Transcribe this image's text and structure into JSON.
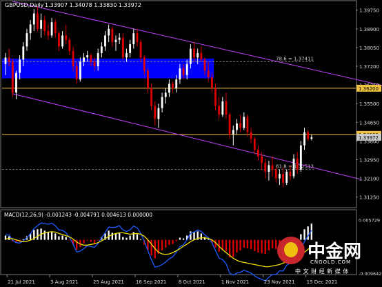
{
  "header": {
    "symbol": "GBPUSD,Daily",
    "ohlc": "1.33907 1.34078 1.33830 1.33972"
  },
  "watermark": {
    "brand": "中金网",
    "domain_sub": "CNGOLD.COM",
    "tagline": "中 文 财 经 新 媒 体"
  },
  "indicator": {
    "label": "MACD(12,26,9) -0.001243 -0.004791 0.004613 0.000000"
  },
  "colors": {
    "background": "#000000",
    "bull_candle": "#ffffff",
    "bear_candle": "#e00000",
    "channel_line": "#c040ff",
    "resistance_zone": "#0000ff",
    "horizontal_level": "#f0c040",
    "macd_signal": "#f0e000",
    "macd_line": "#1e5bff",
    "macd_hist_pos": "#ffffff",
    "macd_hist_neg": "#e00000"
  },
  "chart_data": {
    "type": "candlestick",
    "symbol": "GBPUSD",
    "timeframe": "Daily",
    "price_axis_ticks": [
      "1.39750",
      "1.38900",
      "1.38050",
      "1.37200",
      "1.36350",
      "1.35500",
      "1.34650",
      "1.33800",
      "1.32950",
      "1.32100",
      "1.31250"
    ],
    "ylim": [
      1.308,
      1.4015
    ],
    "x_ticks": [
      "21 Jul 2021",
      "3 Aug 2021",
      "25 Aug 2021",
      "16 Sep 2021",
      "8 Oct 2021",
      "1 Nov 2021",
      "23 Nov 2021",
      "15 Dec 2021"
    ],
    "levels": [
      {
        "label": "78.6 = 1.37411",
        "value": 1.37411,
        "style": "dashed"
      },
      {
        "label": "1.36200",
        "value": 1.362,
        "style": "solid",
        "tag": true
      },
      {
        "label": "1.34100",
        "value": 1.341,
        "style": "solid",
        "tag": true
      },
      {
        "label": "1.33972",
        "value": 1.33972,
        "style": "tag"
      },
      {
        "label": "61.8 = 1.32513",
        "value": 1.32513,
        "style": "dashed"
      }
    ],
    "resistance_zone": {
      "from": 1.3665,
      "to": 1.3755
    },
    "channel": {
      "upper": [
        {
          "date_index": 2,
          "price": 1.4015
        },
        {
          "date_index": 108,
          "price": 1.3625
        }
      ],
      "lower": [
        {
          "date_index": 2,
          "price": 1.3595
        },
        {
          "date_index": 100,
          "price": 1.3205
        }
      ]
    },
    "candles": [
      [
        1.373,
        1.378,
        1.368,
        1.376
      ],
      [
        1.376,
        1.38,
        1.372,
        1.374
      ],
      [
        1.374,
        1.3755,
        1.358,
        1.36
      ],
      [
        1.36,
        1.37,
        1.357,
        1.369
      ],
      [
        1.369,
        1.377,
        1.366,
        1.375
      ],
      [
        1.375,
        1.383,
        1.372,
        1.381
      ],
      [
        1.381,
        1.389,
        1.379,
        1.387
      ],
      [
        1.387,
        1.393,
        1.384,
        1.391
      ],
      [
        1.391,
        1.398,
        1.388,
        1.396
      ],
      [
        1.396,
        1.399,
        1.388,
        1.389
      ],
      [
        1.389,
        1.396,
        1.385,
        1.393
      ],
      [
        1.393,
        1.395,
        1.386,
        1.388
      ],
      [
        1.388,
        1.391,
        1.384,
        1.386
      ],
      [
        1.386,
        1.394,
        1.385,
        1.392
      ],
      [
        1.392,
        1.3935,
        1.385,
        1.387
      ],
      [
        1.387,
        1.388,
        1.379,
        1.381
      ],
      [
        1.381,
        1.388,
        1.38,
        1.386
      ],
      [
        1.386,
        1.391,
        1.382,
        1.384
      ],
      [
        1.384,
        1.385,
        1.377,
        1.379
      ],
      [
        1.379,
        1.381,
        1.37,
        1.372
      ],
      [
        1.372,
        1.374,
        1.364,
        1.366
      ],
      [
        1.366,
        1.376,
        1.365,
        1.374
      ],
      [
        1.374,
        1.378,
        1.372,
        1.376
      ],
      [
        1.376,
        1.379,
        1.374,
        1.377
      ],
      [
        1.377,
        1.378,
        1.372,
        1.374
      ],
      [
        1.374,
        1.376,
        1.37,
        1.372
      ],
      [
        1.372,
        1.38,
        1.37,
        1.378
      ],
      [
        1.378,
        1.383,
        1.376,
        1.381
      ],
      [
        1.381,
        1.388,
        1.379,
        1.386
      ],
      [
        1.386,
        1.391,
        1.383,
        1.389
      ],
      [
        1.389,
        1.39,
        1.381,
        1.383
      ],
      [
        1.383,
        1.386,
        1.379,
        1.384
      ],
      [
        1.384,
        1.387,
        1.382,
        1.385
      ],
      [
        1.385,
        1.387,
        1.375,
        1.376
      ],
      [
        1.376,
        1.38,
        1.374,
        1.378
      ],
      [
        1.378,
        1.384,
        1.376,
        1.382
      ],
      [
        1.382,
        1.389,
        1.38,
        1.387
      ],
      [
        1.387,
        1.389,
        1.381,
        1.383
      ],
      [
        1.383,
        1.384,
        1.374,
        1.376
      ],
      [
        1.376,
        1.377,
        1.368,
        1.37
      ],
      [
        1.37,
        1.371,
        1.36,
        1.362
      ],
      [
        1.362,
        1.364,
        1.352,
        1.354
      ],
      [
        1.354,
        1.356,
        1.345,
        1.348
      ],
      [
        1.348,
        1.355,
        1.344,
        1.353
      ],
      [
        1.353,
        1.36,
        1.351,
        1.358
      ],
      [
        1.358,
        1.362,
        1.355,
        1.36
      ],
      [
        1.36,
        1.366,
        1.358,
        1.364
      ],
      [
        1.364,
        1.365,
        1.36,
        1.362
      ],
      [
        1.362,
        1.368,
        1.36,
        1.366
      ],
      [
        1.366,
        1.373,
        1.364,
        1.371
      ],
      [
        1.371,
        1.373,
        1.366,
        1.368
      ],
      [
        1.368,
        1.375,
        1.366,
        1.373
      ],
      [
        1.373,
        1.382,
        1.371,
        1.38
      ],
      [
        1.38,
        1.383,
        1.374,
        1.376
      ],
      [
        1.376,
        1.38,
        1.373,
        1.378
      ],
      [
        1.378,
        1.381,
        1.374,
        1.375
      ],
      [
        1.375,
        1.376,
        1.368,
        1.37
      ],
      [
        1.37,
        1.374,
        1.365,
        1.367
      ],
      [
        1.367,
        1.369,
        1.36,
        1.362
      ],
      [
        1.362,
        1.364,
        1.352,
        1.354
      ],
      [
        1.354,
        1.358,
        1.348,
        1.35
      ],
      [
        1.35,
        1.358,
        1.349,
        1.356
      ],
      [
        1.356,
        1.36,
        1.348,
        1.35
      ],
      [
        1.35,
        1.351,
        1.339,
        1.341
      ],
      [
        1.341,
        1.345,
        1.336,
        1.343
      ],
      [
        1.343,
        1.348,
        1.341,
        1.346
      ],
      [
        1.346,
        1.35,
        1.342,
        1.344
      ],
      [
        1.344,
        1.351,
        1.343,
        1.349
      ],
      [
        1.349,
        1.35,
        1.34,
        1.342
      ],
      [
        1.342,
        1.344,
        1.337,
        1.339
      ],
      [
        1.339,
        1.34,
        1.332,
        1.334
      ],
      [
        1.334,
        1.336,
        1.329,
        1.331
      ],
      [
        1.331,
        1.333,
        1.325,
        1.328
      ],
      [
        1.328,
        1.33,
        1.321,
        1.324
      ],
      [
        1.324,
        1.329,
        1.32,
        1.327
      ],
      [
        1.327,
        1.331,
        1.322,
        1.325
      ],
      [
        1.325,
        1.326,
        1.319,
        1.321
      ],
      [
        1.321,
        1.325,
        1.318,
        1.323
      ],
      [
        1.323,
        1.326,
        1.317,
        1.319
      ],
      [
        1.319,
        1.325,
        1.318,
        1.324
      ],
      [
        1.324,
        1.327,
        1.32,
        1.322
      ],
      [
        1.322,
        1.332,
        1.321,
        1.33
      ],
      [
        1.33,
        1.333,
        1.323,
        1.325
      ],
      [
        1.325,
        1.338,
        1.324,
        1.336
      ],
      [
        1.336,
        1.344,
        1.334,
        1.342
      ],
      [
        1.342,
        1.343,
        1.338,
        1.339
      ],
      [
        1.339,
        1.3408,
        1.3383,
        1.3397
      ]
    ],
    "macd": {
      "ylim": [
        -0.00964,
        0.00579
      ],
      "ticks": [
        "0.005729",
        "-0.009642"
      ],
      "histogram": [
        0.0012,
        0.001,
        -0.0004,
        -0.0008,
        -0.0006,
        0.0002,
        0.001,
        0.0018,
        0.0028,
        0.003,
        0.0032,
        0.0026,
        0.0022,
        0.0024,
        0.0018,
        0.001,
        0.0012,
        0.0008,
        -0.0002,
        -0.0014,
        -0.0028,
        -0.002,
        -0.001,
        -0.0002,
        -0.0006,
        -0.001,
        -0.0002,
        0.0008,
        0.0018,
        0.0026,
        0.002,
        0.0018,
        0.002,
        0.0008,
        0.0006,
        0.0012,
        0.0022,
        0.0016,
        0.0002,
        -0.0014,
        -0.003,
        -0.0044,
        -0.0052,
        -0.004,
        -0.003,
        -0.0022,
        -0.0014,
        -0.0012,
        -0.0004,
        0.0006,
        0.0004,
        0.0012,
        0.0024,
        0.0022,
        0.0024,
        0.0018,
        0.0008,
        0.0002,
        -0.0008,
        -0.0022,
        -0.0034,
        -0.0028,
        -0.0032,
        -0.005,
        -0.0048,
        -0.0036,
        -0.003,
        -0.0022,
        -0.0024,
        -0.0026,
        -0.0032,
        -0.0036,
        -0.0038,
        -0.004,
        -0.003,
        -0.0024,
        -0.0026,
        -0.0018,
        -0.0022,
        -0.001,
        -0.0008,
        0.0004,
        0.0002,
        0.0016,
        0.003,
        0.0038,
        0.0046
      ],
      "signal": [
        0.0002,
        0.0004,
        0.0003,
        0.0,
        -0.0003,
        -0.0005,
        -0.0004,
        -0.0001,
        0.0004,
        0.001,
        0.0016,
        0.002,
        0.0022,
        0.0023,
        0.0022,
        0.0018,
        0.0015,
        0.0012,
        0.0008,
        0.0002,
        -0.0006,
        -0.0012,
        -0.0015,
        -0.0015,
        -0.0013,
        -0.0011,
        -0.0008,
        -0.0003,
        0.0003,
        0.001,
        0.0015,
        0.0018,
        0.002,
        0.002,
        0.0018,
        0.0016,
        0.0017,
        0.0018,
        0.0016,
        0.001,
        0.0,
        -0.0012,
        -0.0025,
        -0.0035,
        -0.004,
        -0.0041,
        -0.004,
        -0.0036,
        -0.0031,
        -0.0025,
        -0.0018,
        -0.0012,
        -0.0005,
        0.0,
        0.0004,
        0.0006,
        0.0006,
        0.0004,
        0.0,
        -0.0008,
        -0.0018,
        -0.0028,
        -0.0036,
        -0.0044,
        -0.0052,
        -0.0058,
        -0.0062,
        -0.0064,
        -0.0066,
        -0.0068,
        -0.007,
        -0.0072,
        -0.0074,
        -0.0076,
        -0.0076,
        -0.0074,
        -0.0072,
        -0.007,
        -0.0066,
        -0.0062,
        -0.0058,
        -0.0053,
        -0.0048,
        -0.0042,
        -0.0035,
        -0.0027,
        -0.0019
      ],
      "macd_line": [
        0.0014,
        0.0014,
        -0.0001,
        -0.0008,
        -0.0009,
        -0.0003,
        0.0006,
        0.0017,
        0.0032,
        0.004,
        0.0048,
        0.0046,
        0.0044,
        0.0047,
        0.004,
        0.0028,
        0.0027,
        0.002,
        0.0006,
        -0.0012,
        -0.0034,
        -0.0032,
        -0.0025,
        -0.0017,
        -0.0019,
        -0.0021,
        -0.001,
        0.0005,
        0.0021,
        0.0036,
        0.0035,
        0.0036,
        0.004,
        0.0028,
        0.0024,
        0.0028,
        0.0039,
        0.0034,
        0.0018,
        -0.0004,
        -0.003,
        -0.0056,
        -0.0077,
        -0.0075,
        -0.007,
        -0.0063,
        -0.0054,
        -0.0048,
        -0.0035,
        -0.0019,
        -0.0014,
        0.0,
        0.0019,
        0.0022,
        0.0028,
        0.0024,
        0.0014,
        0.0006,
        -0.0008,
        -0.003,
        -0.0052,
        -0.0056,
        -0.0068,
        -0.0094,
        -0.01,
        -0.0094,
        -0.0092,
        -0.0086,
        -0.009,
        -0.0094,
        -0.0102,
        -0.0108,
        -0.0112,
        -0.0116,
        -0.0106,
        -0.0098,
        -0.0098,
        -0.0088,
        -0.0088,
        -0.0072,
        -0.0066,
        -0.0049,
        -0.0046,
        -0.0026,
        -0.0005,
        0.0011,
        0.0027
      ]
    }
  }
}
